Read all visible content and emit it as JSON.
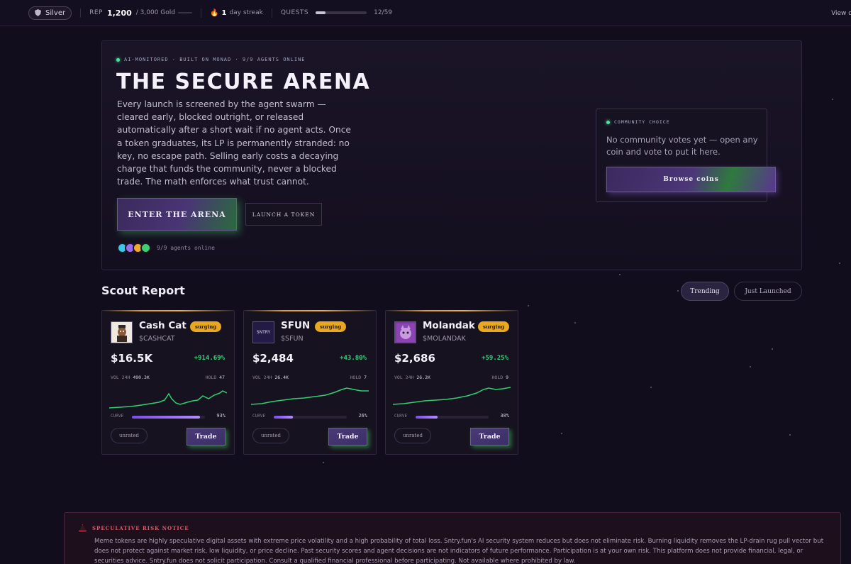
{
  "topbar": {
    "tier": "Silver",
    "rep_label": "REP",
    "rep_value": "1,200",
    "rep_max": "/ 3,000 Gold",
    "streak_num": "1",
    "streak_label": "day streak",
    "quests_label": "QUESTS",
    "quests_count": "12/59",
    "quests_progress": 0.2,
    "view_link": "View q"
  },
  "hero": {
    "meta": "AI-MONITORED · BUILT ON MONAD · 9/9 AGENTS ONLINE",
    "title": "THE SECURE ARENA",
    "description": "Every launch is screened by the agent swarm — cleared early, blocked outright, or released automatically after a short wait if no agent acts. Once a token graduates, its LP is permanently stranded: no key, no escape path. Selling early costs a decaying charge that funds the community, never a blocked trade. The math enforces what trust cannot.",
    "enter_label": "ENTER THE ARENA",
    "launch_label": "LAUNCH A TOKEN",
    "agents_label": "9/9 agents online",
    "agent_colors": [
      "#38c8e8",
      "#9b6cf0",
      "#f0a830",
      "#3ed070"
    ]
  },
  "community": {
    "tag": "COMMUNITY CHOICE",
    "text": "No community votes yet — open any coin and vote to put it here.",
    "browse_label": "Browse coins"
  },
  "scout": {
    "title": "Scout Report",
    "tab_trending": "Trending",
    "tab_launched": "Just Launched",
    "cards": [
      {
        "name": "Cash Cat",
        "badge": "surging",
        "ticker": "$CASHCAT",
        "price": "$16.5K",
        "change": "+914.69%",
        "vol_label": "VOL 24H",
        "vol": "490.3K",
        "hold_label": "HOLD",
        "hold": "47",
        "curve_label": "CURVE",
        "curve_pct": "93%",
        "curve": 0.93,
        "rating": "unrated",
        "trade": "Trade",
        "thumb_icon": "cat-avatar-icon",
        "thumb_text": ""
      },
      {
        "name": "SFUN",
        "badge": "surging",
        "ticker": "$SFUN",
        "price": "$2,484",
        "change": "+43.80%",
        "vol_label": "VOL 24H",
        "vol": "26.4K",
        "hold_label": "HOLD",
        "hold": "7",
        "curve_label": "CURVE",
        "curve_pct": "26%",
        "curve": 0.26,
        "rating": "unrated",
        "trade": "Trade",
        "thumb_icon": "sntry-logo-icon",
        "thumb_text": "SNTRY"
      },
      {
        "name": "Molandak",
        "badge": "surging",
        "ticker": "$MOLANDAK",
        "price": "$2,686",
        "change": "+59.25%",
        "vol_label": "VOL 24H",
        "vol": "26.2K",
        "hold_label": "HOLD",
        "hold": "9",
        "curve_label": "CURVE",
        "curve_pct": "30%",
        "curve": 0.3,
        "rating": "unrated",
        "trade": "Trade",
        "thumb_icon": "molandak-avatar-icon",
        "thumb_text": ""
      }
    ]
  },
  "risk": {
    "title": "SPECULATIVE RISK NOTICE",
    "text": "Meme tokens are highly speculative digital assets with extreme price volatility and a high probability of total loss. Sntry.fun's AI security system reduces but does not eliminate risk. Burning liquidity removes the LP-drain rug pull vector but does not protect against market risk, low liquidity, or price decline. Past security scores and agent decisions are not indicators of future performance. Participation is at your own risk. This platform does not provide financial, legal, or securities advice. Sntry.fun does not solicit participation. Consult a qualified financial professional before participating. Not available where prohibited by law."
  },
  "colors": {
    "accent_green": "#35d07a",
    "accent_purple": "#7b4fe0",
    "badge_gold": "#e8a81f",
    "risk_red": "#e2556a"
  }
}
